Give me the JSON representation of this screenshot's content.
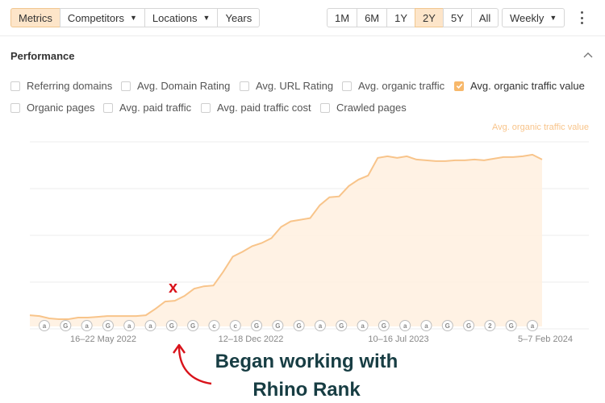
{
  "toolbar": {
    "left_tabs": [
      {
        "label": "Metrics",
        "active": true,
        "dropdown": false
      },
      {
        "label": "Competitors",
        "active": false,
        "dropdown": true
      },
      {
        "label": "Locations",
        "active": false,
        "dropdown": true
      },
      {
        "label": "Years",
        "active": false,
        "dropdown": false
      }
    ],
    "ranges": [
      {
        "label": "1M",
        "active": false
      },
      {
        "label": "6M",
        "active": false
      },
      {
        "label": "1Y",
        "active": false
      },
      {
        "label": "2Y",
        "active": true
      },
      {
        "label": "5Y",
        "active": false
      },
      {
        "label": "All",
        "active": false
      }
    ],
    "interval": "Weekly"
  },
  "panel": {
    "title": "Performance",
    "metrics": [
      {
        "label": "Referring domains",
        "checked": false
      },
      {
        "label": "Avg. Domain Rating",
        "checked": false
      },
      {
        "label": "Avg. URL Rating",
        "checked": false
      },
      {
        "label": "Avg. organic traffic",
        "checked": false
      },
      {
        "label": "Avg. organic traffic value",
        "checked": true
      },
      {
        "label": "Organic pages",
        "checked": false
      },
      {
        "label": "Avg. paid traffic",
        "checked": false
      },
      {
        "label": "Avg. paid traffic cost",
        "checked": false
      },
      {
        "label": "Crawled pages",
        "checked": false
      }
    ]
  },
  "chart_data": {
    "type": "area",
    "series": [
      {
        "name": "Avg. organic traffic value",
        "color": "#f8c48a",
        "values": [
          14,
          13,
          10,
          9,
          9,
          11,
          11,
          12,
          13,
          13,
          13,
          13,
          14,
          22,
          31,
          32,
          38,
          47,
          50,
          51,
          68,
          87,
          93,
          100,
          104,
          110,
          124,
          131,
          133,
          135,
          151,
          161,
          162,
          175,
          183,
          188,
          210,
          212,
          210,
          212,
          208,
          207,
          206,
          206,
          207,
          207,
          208,
          207,
          209,
          211,
          211,
          212,
          214,
          208
        ]
      }
    ],
    "x_tick_labels": [
      "16–22 May 2022",
      "12–18 Dec 2022",
      "10–16 Jul 2023",
      "5–7 Feb 2024"
    ],
    "ylim": [
      0,
      230
    ],
    "gridlines": 5,
    "annotations": [
      "a",
      "G",
      "a",
      "G",
      "a",
      "a",
      "G",
      "G",
      "c",
      "c",
      "G",
      "G",
      "G",
      "a",
      "G",
      "a",
      "G",
      "a",
      "a",
      "G",
      "G",
      "2",
      "G",
      "a"
    ]
  },
  "overlay": {
    "marker": "x",
    "caption_line1": "Began working with",
    "caption_line2": "Rhino Rank",
    "marker_color": "#d9131b",
    "caption_color": "#173d43"
  }
}
